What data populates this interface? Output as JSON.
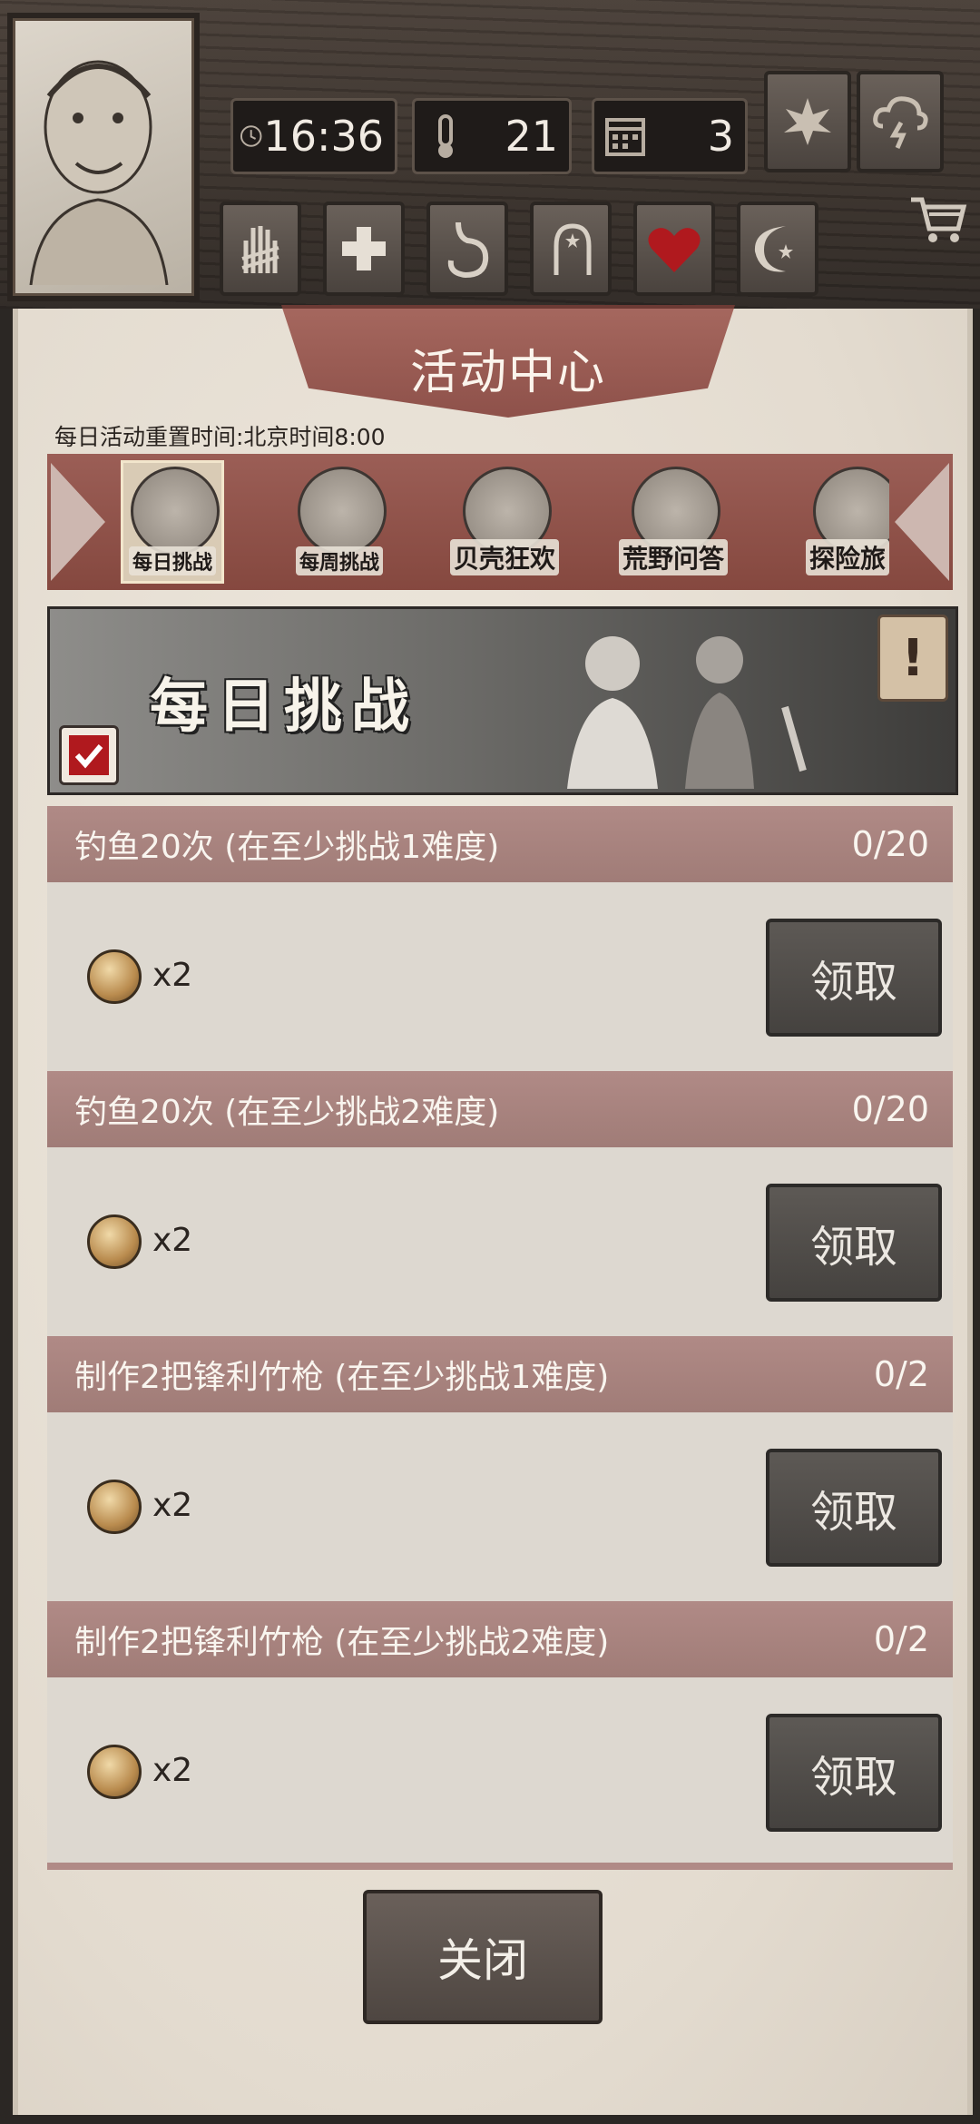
{
  "hud": {
    "time": "16:36",
    "temperature": "21",
    "day": "3",
    "icons": {
      "clock": "clock-icon",
      "thermometer": "thermometer-icon",
      "calendar": "calendar-icon",
      "leaf": "leaf-icon",
      "weather": "thunderstorm-icon",
      "cart": "shopping-cart-icon"
    },
    "status_buttons": [
      "bandaged-hand-icon",
      "medical-cross-icon",
      "stomach-icon",
      "head-icon",
      "heart-icon",
      "moon-star-icon"
    ]
  },
  "panel": {
    "title": "活动中心",
    "reset_info": "每日活动重置时间:北京时间8:00",
    "tabs": [
      {
        "label": "每日挑战",
        "selected": true
      },
      {
        "label": "每周挑战",
        "selected": false
      },
      {
        "label": "贝壳狂欢",
        "selected": false
      },
      {
        "label": "荒野问答",
        "selected": false
      },
      {
        "label": "探险旅",
        "selected": false
      }
    ],
    "banner_title": "每日挑战",
    "info_button": "!",
    "tasks": [
      {
        "name": "钓鱼20次 (在至少挑战1难度)",
        "progress": "0/20",
        "reward": "x2",
        "claim_label": "领取"
      },
      {
        "name": "钓鱼20次 (在至少挑战2难度)",
        "progress": "0/20",
        "reward": "x2",
        "claim_label": "领取"
      },
      {
        "name": "制作2把锋利竹枪 (在至少挑战1难度)",
        "progress": "0/2",
        "reward": "x2",
        "claim_label": "领取"
      },
      {
        "name": "制作2把锋利竹枪 (在至少挑战2难度)",
        "progress": "0/2",
        "reward": "x2",
        "claim_label": "领取"
      }
    ],
    "close_label": "关闭"
  },
  "colors": {
    "panel_bg": "#e9e3d9",
    "banner_red": "#9b5e56",
    "task_header": "#b08a86",
    "claim_button": "#4f4b48"
  }
}
